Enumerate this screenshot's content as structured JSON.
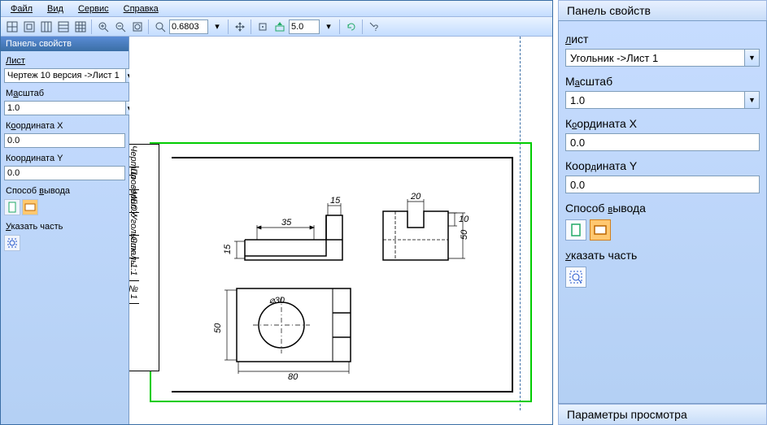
{
  "menu": {
    "file": "Файл",
    "view": "Вид",
    "service": "Сервис",
    "help": "Справка"
  },
  "toolbar": {
    "zoom_value": "0.6803",
    "scale_value": "5.0"
  },
  "sidebar_left": {
    "title": "Панель свойств",
    "sheet_label": "Лист",
    "sheet_value": "Чертеж 10 версия ->Лист 1",
    "scale_label": "Масштаб",
    "scale_value": "1.0",
    "coordx_label": "Координата X",
    "coordx_value": "0.0",
    "coordy_label": "Координата Y",
    "coordy_value": "0.0",
    "output_label": "Способ вывода",
    "part_label": "Указать часть"
  },
  "right_panel": {
    "title": "Панель свойств",
    "sheet_label": "Лист",
    "sheet_value": "Угольник ->Лист 1",
    "scale_label": "Масштаб",
    "scale_value": "1.0",
    "coordx_label": "Координата X",
    "coordx_value": "0.0",
    "coordy_label": "Координата Y",
    "coordy_value": "0.0",
    "output_label": "Способ вывода",
    "part_label": "Указать часть",
    "bottom_tab": "Параметры просмотра"
  },
  "drawing": {
    "dims": {
      "d15": "15",
      "d20": "20",
      "d35": "35",
      "d10": "10",
      "d50": "50",
      "d80": "80",
      "dia30": "⌀30",
      "d15v": "15",
      "d50v": "50"
    }
  }
}
